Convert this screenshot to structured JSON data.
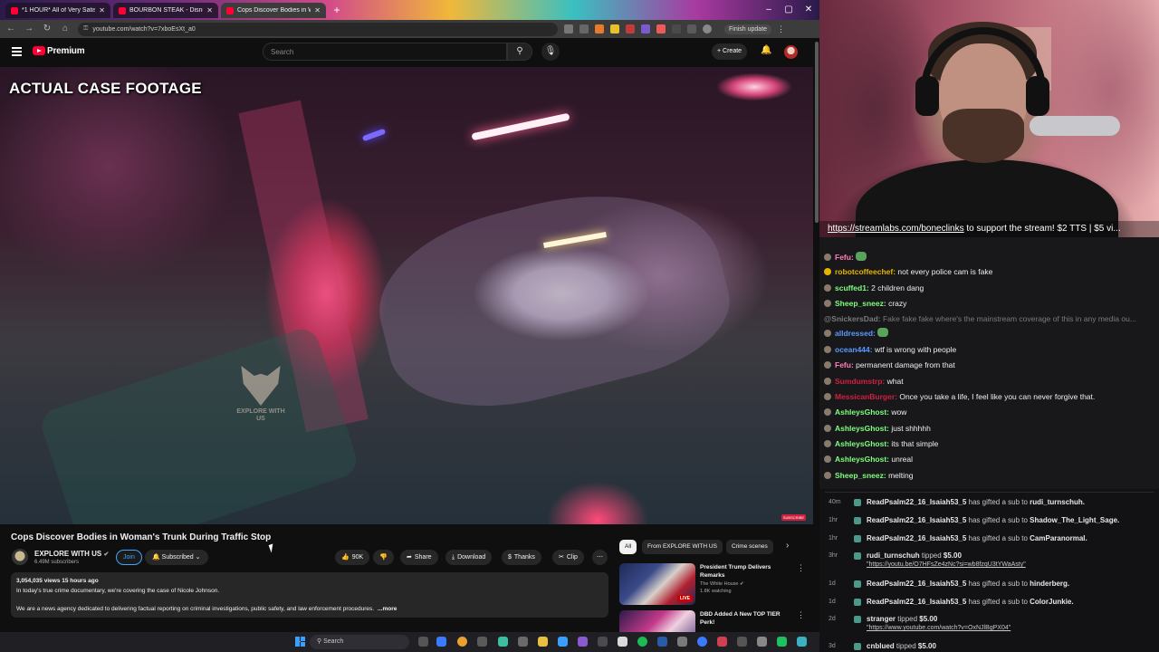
{
  "browser": {
    "tabs": [
      {
        "label": "*1 HOUR* All of Very Satisfying"
      },
      {
        "label": "BOURBON STEAK - Disney Wo"
      },
      {
        "label": "Cops Discover Bodies in W"
      }
    ],
    "url": "youtube.com/watch?v=7xboEsXt_a0",
    "finish_update": "Finish update"
  },
  "youtube": {
    "brand": "Premium",
    "search_placeholder": "Search",
    "create_label": "Create"
  },
  "video": {
    "caption": "ACTUAL CASE FOOTAGE",
    "watermark": "EXPLORE WITH US",
    "title": "Cops Discover Bodies in Woman's Trunk During Traffic Stop",
    "channel": "EXPLORE WITH US",
    "subscribers": "6.49M subscribers",
    "join": "Join",
    "subscribed": "Subscribed",
    "likes": "90K",
    "share": "Share",
    "download": "Download",
    "thanks": "Thanks",
    "clip": "Clip",
    "views_time": "3,054,035 views  15 hours ago",
    "desc_line1": "In today's true crime documentary, we're covering the case of Nicole Johnson.",
    "desc_line2": "We are a news agency dedicated to delivering factual reporting on criminal investigations, public safety, and law enforcement procedures.",
    "more": "...more"
  },
  "sidebar": {
    "chips": [
      "All",
      "From EXPLORE WITH US",
      "Crime scenes"
    ],
    "recs": [
      {
        "title": "President Trump Delivers Remarks",
        "channel": "The White House",
        "watching": "1.8K watching",
        "badge": "LIVE"
      },
      {
        "title": "DBD Added A New TOP TIER Perk!",
        "channel": "",
        "watching": ""
      }
    ]
  },
  "taskbar": {
    "search": "Search"
  },
  "stream": {
    "banner_link": "https://streamlabs.com/boneclinks",
    "banner_rest": " to support the stream! $2 TTS | $5 vi..."
  },
  "chat": [
    {
      "user": "Fefu:",
      "text": "",
      "color": "#ff7fbf",
      "emote": true
    },
    {
      "user": "robotcoffeechef:",
      "text": " not every police cam is fake",
      "color": "#e6b400"
    },
    {
      "user": "scuffed1:",
      "text": " 2 children dang",
      "color": "#7fff7f"
    },
    {
      "user": "Sheep_sneez:",
      "text": " crazy",
      "color": "#7fff7f"
    },
    {
      "user": "@SnickersDad:",
      "text": " Fake fake fake where's the mainstream coverage of this in any media ou...",
      "color": "#7a7a7e",
      "dim": true
    },
    {
      "user": "alldressed:",
      "text": "",
      "color": "#5a9aff",
      "emote": true
    },
    {
      "user": "ocean444:",
      "text": " wtf is wrong with people",
      "color": "#5a9aff"
    },
    {
      "user": "Fefu:",
      "text": " permanent damage from that",
      "color": "#ff7fbf"
    },
    {
      "user": "Sumdumstrp:",
      "text": " what",
      "color": "#d02040"
    },
    {
      "user": "MessicanBurger:",
      "text": " Once you take a life, I feel like you can never forgive that.",
      "color": "#d02040"
    },
    {
      "user": "AshleysGhost:",
      "text": " wow",
      "color": "#7fff7f"
    },
    {
      "user": "AshleysGhost:",
      "text": " just shhhhh",
      "color": "#7fff7f"
    },
    {
      "user": "AshleysGhost:",
      "text": " its that simple",
      "color": "#7fff7f"
    },
    {
      "user": "AshleysGhost:",
      "text": " unreal",
      "color": "#7fff7f"
    },
    {
      "user": "Sheep_sneez:",
      "text": " melting",
      "color": "#7fff7f"
    }
  ],
  "events": [
    {
      "age": "40m",
      "who": "ReadPsalm22_16_Isaiah53_5",
      "mid": " has gifted a sub to ",
      "target": "rudi_turnschuh."
    },
    {
      "age": "1hr",
      "who": "ReadPsalm22_16_Isaiah53_5",
      "mid": " has gifted a sub to ",
      "target": "Shadow_The_Light_Sage."
    },
    {
      "age": "1hr",
      "who": "ReadPsalm22_16_Isaiah53_5",
      "mid": " has gifted a sub to ",
      "target": "CamParanormal."
    },
    {
      "age": "3hr",
      "who": "rudi_turnschuh",
      "mid": " tipped ",
      "target": "$5.00",
      "url": "\"https://youtu.be/O7HFsZe4zNc?si=wb8fzqU3tYWaAsty\""
    },
    {
      "age": "1d",
      "who": "ReadPsalm22_16_Isaiah53_5",
      "mid": " has gifted a sub to ",
      "target": "hinderberg."
    },
    {
      "age": "1d",
      "who": "ReadPsalm22_16_Isaiah53_5",
      "mid": " has gifted a sub to ",
      "target": "ColorJunkie."
    },
    {
      "age": "2d",
      "who": "stranger",
      "mid": " tipped ",
      "target": "$5.00",
      "url": "\"https://www.youtube.com/watch?v=OxNJlBgPX04\""
    },
    {
      "age": "3d",
      "who": "cnblued",
      "mid": " tipped ",
      "target": "$5.00"
    }
  ]
}
